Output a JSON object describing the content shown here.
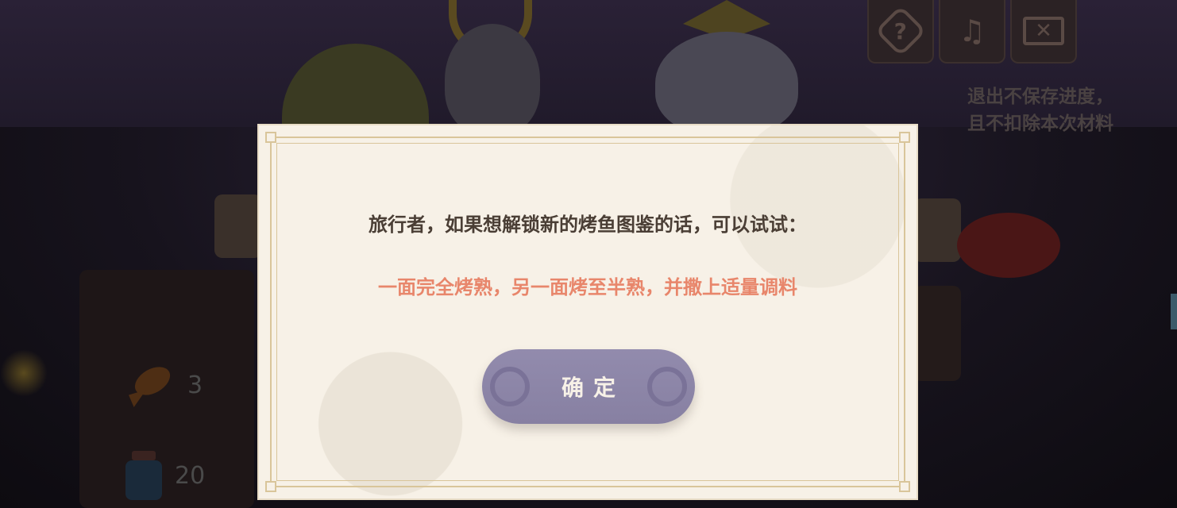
{
  "top_controls": {
    "help_icon": "question-icon",
    "help_glyph": "?",
    "music_icon": "music-note-icon",
    "music_glyph": "♫",
    "exit_icon": "exit-icon",
    "exit_glyph": "✕",
    "exit_note_line1": "退出不保存进度，",
    "exit_note_line2": "且不扣除本次材料"
  },
  "inventory": {
    "fish_count": "3",
    "seasoning_count": "20"
  },
  "modal": {
    "message": "旅行者，如果想解锁新的烤鱼图鉴的话，可以试试：",
    "hint": "一面完全烤熟，另一面烤至半熟，并撒上适量调料",
    "confirm_label": "确定"
  },
  "colors": {
    "hint": "#e8866b",
    "button": "#8c85a7",
    "panel": "#f7f1e7"
  }
}
